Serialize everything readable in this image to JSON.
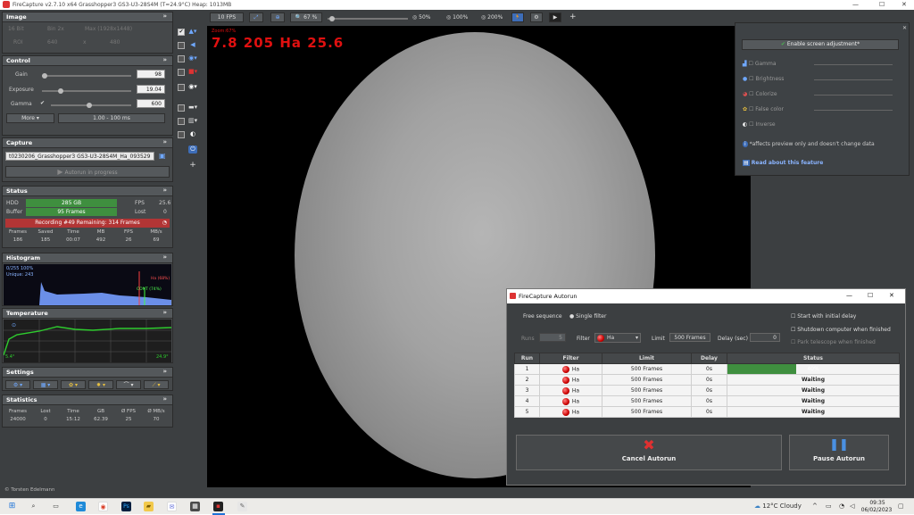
{
  "window": {
    "title": "FireCapture v2.7.10 x64   Grasshopper3 GS3-U3-28S4M (T=24.9°C)   Heap: 1013MB"
  },
  "image_panel": {
    "title": "Image",
    "opt_16bit": "16 Bit",
    "opt_bin": "Bin 2x",
    "opt_max": "Max (1928x1448)",
    "roi_label": "ROI",
    "roi_w": "640",
    "roi_x": "x",
    "roi_h": "480"
  },
  "control_panel": {
    "title": "Control",
    "gain_label": "Gain",
    "gain_value": "98",
    "exposure_label": "Exposure",
    "exposure_value": "19.04",
    "gamma_label": "Gamma",
    "gamma_value": "600",
    "more_label": "More",
    "range_value": "1.00 - 100 ms"
  },
  "capture_panel": {
    "title": "Capture",
    "filename": "t0230206_Grasshopper3 GS3-U3-28S4M_Ha_093529",
    "autorun_label": "Autorun in progress"
  },
  "status_panel": {
    "title": "Status",
    "hdd_label": "HDD",
    "hdd_value": "285 GB",
    "buffer_label": "Buffer",
    "buffer_value": "95 Frames",
    "fps_label": "FPS",
    "fps_value": "25.6",
    "lost_label": "Lost",
    "lost_value": "0",
    "recording": "Recording #49   Remaining: 314 Frames",
    "headers": [
      "Frames",
      "Saved",
      "Time",
      "MB",
      "FPS",
      "MB/s"
    ],
    "values": [
      "186",
      "185",
      "00:07",
      "492",
      "26",
      "69"
    ]
  },
  "histogram_panel": {
    "title": "Histogram",
    "info1": "0/255 100%",
    "info2": "Unique: 243",
    "marker_ha": "Ha (68%)",
    "marker_cont": "CONT (74%)"
  },
  "temperature_panel": {
    "title": "Temperature",
    "low": "5.4°",
    "high": "24.9°"
  },
  "settings_panel": {
    "title": "Settings"
  },
  "statistics_panel": {
    "title": "Statistics",
    "headers": [
      "Frames",
      "Lost",
      "Time",
      "GB",
      "Ø FPS",
      "Ø MB/s"
    ],
    "values": [
      "24000",
      "0",
      "15:12",
      "62.39",
      "25",
      "70"
    ]
  },
  "toolbar": {
    "fps_button": "10 FPS",
    "zoom_value": "67 %",
    "zoom_50": "50%",
    "zoom_100": "100%",
    "zoom_200": "200%",
    "plus": "+"
  },
  "viewer": {
    "zoom_text": "Zoom:67%",
    "overlay": "7.8  205  Ha  25.6"
  },
  "screen_adjust": {
    "enable_button": "Enable screen adjustment*",
    "gamma": "Gamma",
    "brightness": "Brightness",
    "colorize": "Colorize",
    "false_color": "False color",
    "inverse": "Inverse",
    "note": "*affects preview only and doesn't change data",
    "read_link": "Read about this feature"
  },
  "autorun": {
    "title": "FireCapture Autorun",
    "free_sequence": "Free sequence",
    "single_filter": "Single filter",
    "runs_label": "Runs",
    "runs_value": "5",
    "filter_label": "Filter",
    "filter_value": "Ha",
    "limit_label": "Limit",
    "limit_value": "500 Frames",
    "delay_label": "Delay (sec)",
    "delay_value": "0",
    "start_delay": "Start with initial delay",
    "shutdown": "Shutdown computer when finished",
    "park": "Park telescope when finished",
    "columns": [
      "Run",
      "Filter",
      "Limit",
      "Delay",
      "Status"
    ],
    "rows": [
      {
        "run": "1",
        "filter": "Ha",
        "limit": "500 Frames",
        "delay": "0s",
        "status": "40%"
      },
      {
        "run": "2",
        "filter": "Ha",
        "limit": "500 Frames",
        "delay": "0s",
        "status": "Waiting"
      },
      {
        "run": "3",
        "filter": "Ha",
        "limit": "500 Frames",
        "delay": "0s",
        "status": "Waiting"
      },
      {
        "run": "4",
        "filter": "Ha",
        "limit": "500 Frames",
        "delay": "0s",
        "status": "Waiting"
      },
      {
        "run": "5",
        "filter": "Ha",
        "limit": "500 Frames",
        "delay": "0s",
        "status": "Waiting"
      }
    ],
    "progress_fraction": 0.4,
    "cancel_label": "Cancel Autorun",
    "pause_label": "Pause Autorun"
  },
  "footer": {
    "credit": "© Torsten Edelmann"
  },
  "taskbar": {
    "weather": "12°C  Cloudy",
    "time": "09:35",
    "date": "06/02/2023"
  },
  "colors": {
    "panel_bg": "#3c3f41",
    "progress_green": "#3f8f3f",
    "overlay_red": "#e01010",
    "accent_blue": "#4a90e2"
  }
}
